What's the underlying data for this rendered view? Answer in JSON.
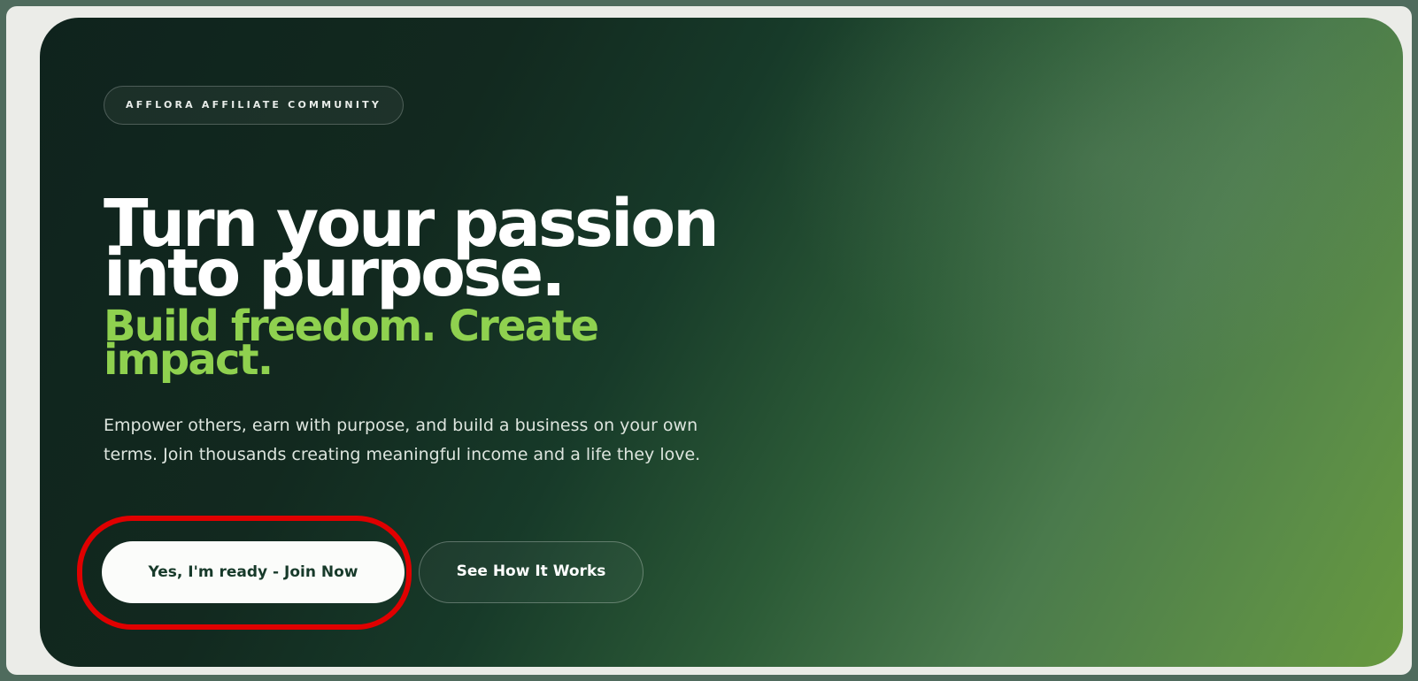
{
  "hero": {
    "badge": "AFFLORA AFFILIATE COMMUNITY",
    "headline_line1": "Turn your passion",
    "headline_line2": "into purpose.",
    "subheadline_line1": "Build freedom. Create",
    "subheadline_line2": "impact.",
    "description": "Empower others, earn with purpose, and build a business on your own terms. Join thousands creating meaningful income and a life they love.",
    "primary_button": "Yes, I'm ready - Join Now",
    "secondary_button": "See How It Works"
  },
  "colors": {
    "accent_green": "#8fd14f",
    "dark_green": "#0f231d",
    "highlight_red": "#e00000"
  }
}
